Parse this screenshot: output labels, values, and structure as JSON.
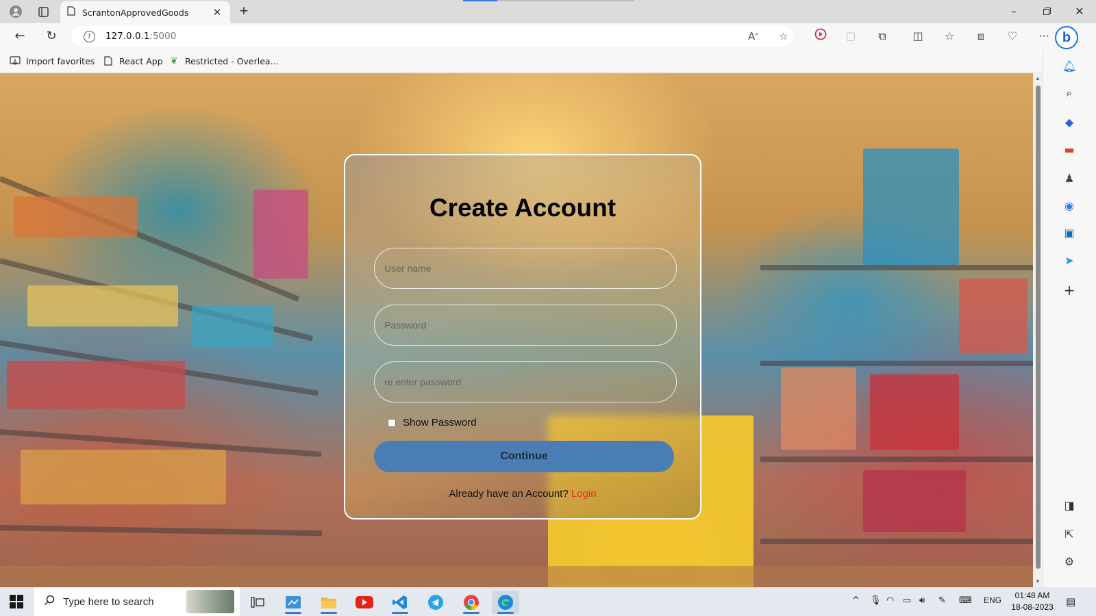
{
  "browser": {
    "tab_title": "ScrantonApprovedGoods",
    "url_host": "127.0.0.1",
    "url_port": ":5000",
    "favorites": [
      {
        "label": "Import favorites"
      },
      {
        "label": "React App"
      },
      {
        "label": "Restricted - Overlea..."
      }
    ]
  },
  "form": {
    "title": "Create Account",
    "username_placeholder": "User name",
    "password_placeholder": "Password",
    "reenter_placeholder": "re enter password",
    "show_password_label": "Show Password",
    "continue_label": "Continue",
    "login_prompt": "Already have an Account?",
    "login_link": "Login"
  },
  "taskbar": {
    "search_placeholder": "Type here to search",
    "language": "ENG",
    "time": "01:48 AM",
    "date": "18-08-2023"
  },
  "colors": {
    "accent": "#4a7db3",
    "login_link": "#e1301f",
    "edge_blue": "#1560d4"
  }
}
